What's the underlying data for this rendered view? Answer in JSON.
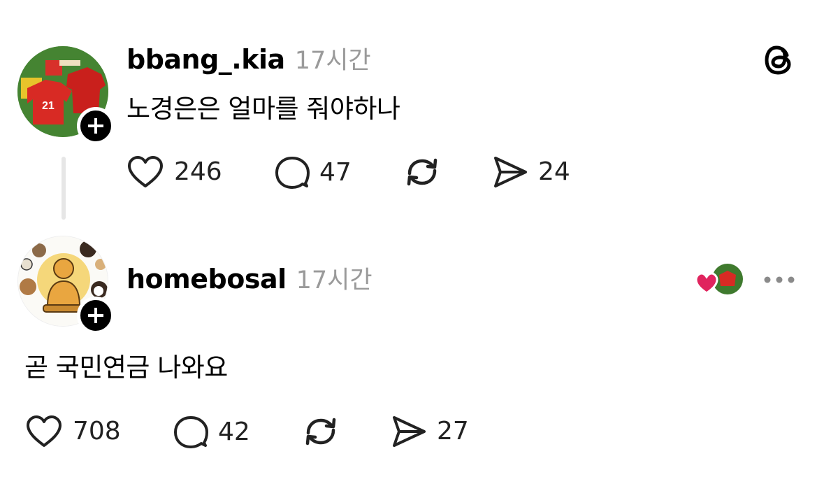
{
  "app": {
    "logo_icon": "threads-logo-icon"
  },
  "posts": [
    {
      "username": "bbang_.kia",
      "time": "17시간",
      "text": "노경은은 얼마를 줘야하나",
      "likes": "246",
      "replies": "47",
      "shares": "24"
    },
    {
      "username": "homebosal",
      "time": "17시간",
      "text": "곧 국민연금 나와요",
      "likes": "708",
      "replies": "42",
      "shares": "27"
    }
  ],
  "colors": {
    "heart": "#e0245e",
    "muted": "#9a9a9a"
  }
}
